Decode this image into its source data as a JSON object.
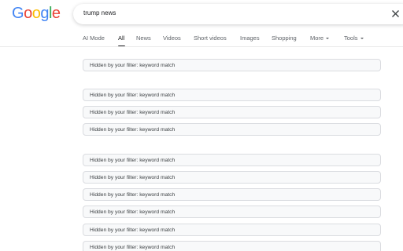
{
  "logo": {
    "text": "Google",
    "letters": [
      {
        "char": "G",
        "color": "#4285F4"
      },
      {
        "char": "o",
        "color": "#EA4335"
      },
      {
        "char": "o",
        "color": "#FBBC05"
      },
      {
        "char": "g",
        "color": "#4285F4"
      },
      {
        "char": "l",
        "color": "#34A853"
      },
      {
        "char": "e",
        "color": "#EA4335"
      }
    ]
  },
  "search": {
    "value": "trump news",
    "clear_icon": "close-icon"
  },
  "tabs": [
    {
      "label": "AI Mode",
      "active": false
    },
    {
      "label": "All",
      "active": true
    },
    {
      "label": "News",
      "active": false
    },
    {
      "label": "Videos",
      "active": false
    },
    {
      "label": "Short videos",
      "active": false
    },
    {
      "label": "Images",
      "active": false
    },
    {
      "label": "Shopping",
      "active": false
    },
    {
      "label": "More",
      "active": false,
      "dropdown": true
    },
    {
      "label": "Tools",
      "active": false,
      "dropdown": true
    }
  ],
  "results": [
    {
      "text": "Hidden by your filter: keyword match"
    },
    {
      "text": "Hidden by your filter: keyword match"
    },
    {
      "text": "Hidden by your filter: keyword match"
    },
    {
      "text": "Hidden by your filter: keyword match"
    },
    {
      "text": "Hidden by your filter: keyword match"
    },
    {
      "text": "Hidden by your filter: keyword match"
    },
    {
      "text": "Hidden by your filter: keyword match"
    },
    {
      "text": "Hidden by your filter: keyword match"
    },
    {
      "text": "Hidden by your filter: keyword match"
    },
    {
      "text": "Hidden by your filter: keyword match"
    }
  ],
  "colors": {
    "accent": "#202124",
    "tab_inactive": "#5f6368",
    "result_border": "#dadce0",
    "result_background": "#f8f9fa"
  }
}
